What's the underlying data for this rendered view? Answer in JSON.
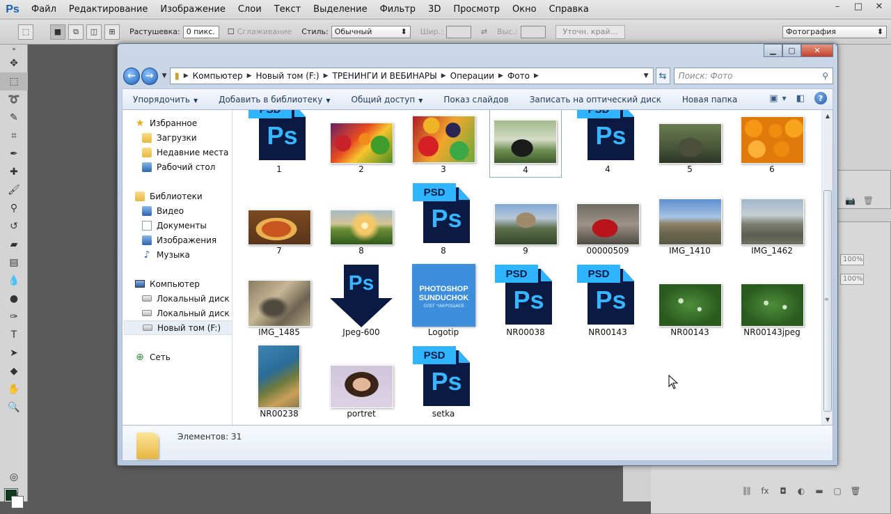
{
  "ps": {
    "logo": "Ps",
    "menu": [
      "Файл",
      "Редактирование",
      "Изображение",
      "Слои",
      "Текст",
      "Выделение",
      "Фильтр",
      "3D",
      "Просмотр",
      "Окно",
      "Справка"
    ],
    "window_controls": [
      "–",
      "□",
      "✕"
    ],
    "options": {
      "feather_label": "Растушевка:",
      "feather_value": "0 пикс.",
      "antialias_label": "Сглаживание",
      "style_label": "Стиль:",
      "style_value": "Обычный",
      "width_label": "Шир.:",
      "height_label": "Выс.:",
      "refine_button": "Уточн. край...",
      "workspace": "Фотография"
    },
    "panel_percent_1": "100%",
    "panel_percent_2": "100%"
  },
  "explorer": {
    "window_controls": [
      "▁",
      "▢",
      "✕"
    ],
    "breadcrumb": [
      "Компьютер",
      "Новый том (F:)",
      "ТРЕНИНГИ И ВЕБИНАРЫ",
      "Операции",
      "Фото"
    ],
    "search_placeholder": "Поиск: Фото",
    "commands": {
      "organize": "Упорядочить",
      "add_library": "Добавить в библиотеку",
      "share": "Общий доступ",
      "slideshow": "Показ слайдов",
      "burn": "Записать на оптический диск",
      "new_folder": "Новая папка"
    },
    "nav": {
      "favorites": "Избранное",
      "downloads": "Загрузки",
      "recent": "Недавние места",
      "desktop": "Рабочий стол",
      "libraries": "Библиотеки",
      "video": "Видео",
      "documents": "Документы",
      "images": "Изображения",
      "music": "Музыка",
      "computer": "Компьютер",
      "local_c": "Локальный диск (C:)",
      "local_e": "Локальный диск (E:)",
      "new_volume": "Новый том (F:)",
      "network": "Сеть"
    },
    "files": [
      "1",
      "2",
      "3",
      "4",
      "4",
      "5",
      "6",
      "7",
      "8",
      "8",
      "9",
      "00000509",
      "IMG_1410",
      "IMG_1462",
      "IMG_1485",
      "Jpeg-600",
      "Logotip",
      "NR00038",
      "NR00143",
      "NR00143",
      "NR00143jpeg",
      "NR00238",
      "portret",
      "setka"
    ],
    "psd_tab": "PSD",
    "ps_letters": "Ps",
    "logo_line1": "PHOTOSHOP",
    "logo_line2": "SUNDUCHOK",
    "logo_line3": "ОЛЕГ ЧАКРОЩАЕВ",
    "status": "Элементов: 31"
  }
}
